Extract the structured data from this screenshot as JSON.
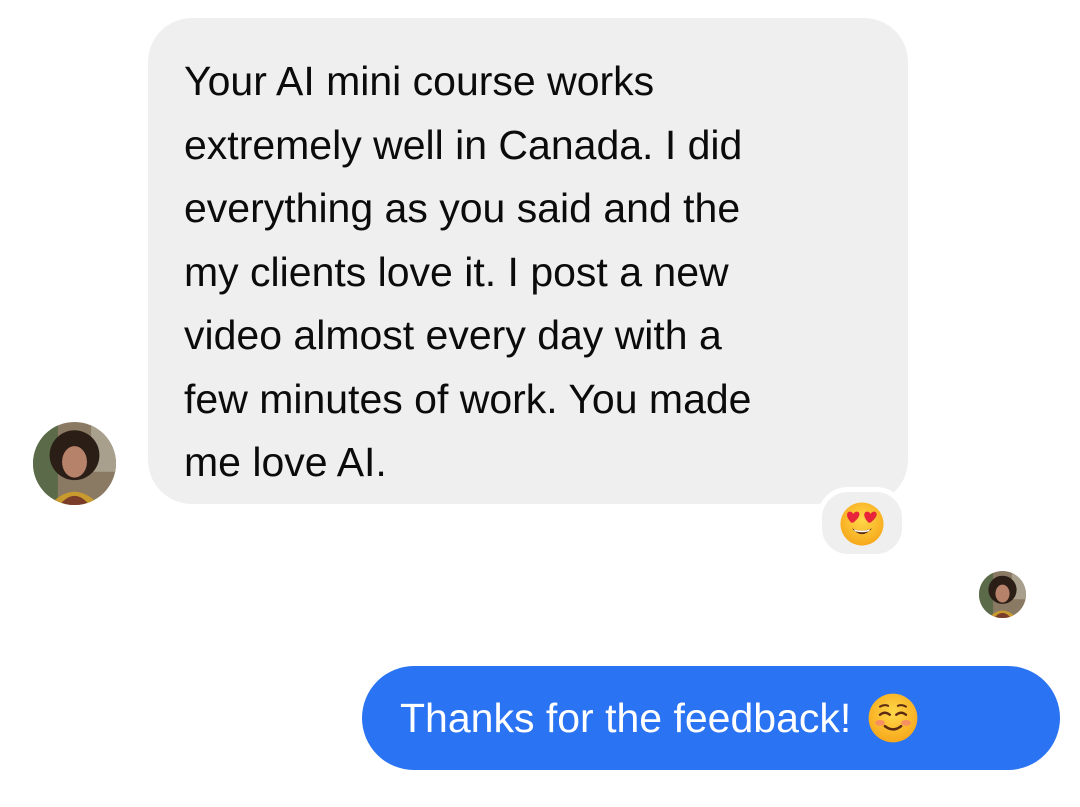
{
  "conversation": {
    "incoming_message": {
      "text": "Your AI mini course works\nextremely well in Canada. I did\neverything as you said and the\nmy clients love it. I post a new\nvideo almost every day with a\nfew minutes of work. You made\nme love AI.",
      "reaction_icon": "heart-eyes-emoji-icon"
    },
    "outgoing_message": {
      "text": "Thanks for the feedback!",
      "emoji_icon": "smiling-blush-emoji-icon"
    },
    "sender_avatar_icon": "contact-avatar",
    "seen_avatar_icon": "seen-receipt-avatar"
  },
  "colors": {
    "incoming_bubble": "#efefef",
    "outgoing_bubble": "#2a73f3",
    "incoming_text": "#0b0b0b",
    "outgoing_text": "#ffffff"
  }
}
